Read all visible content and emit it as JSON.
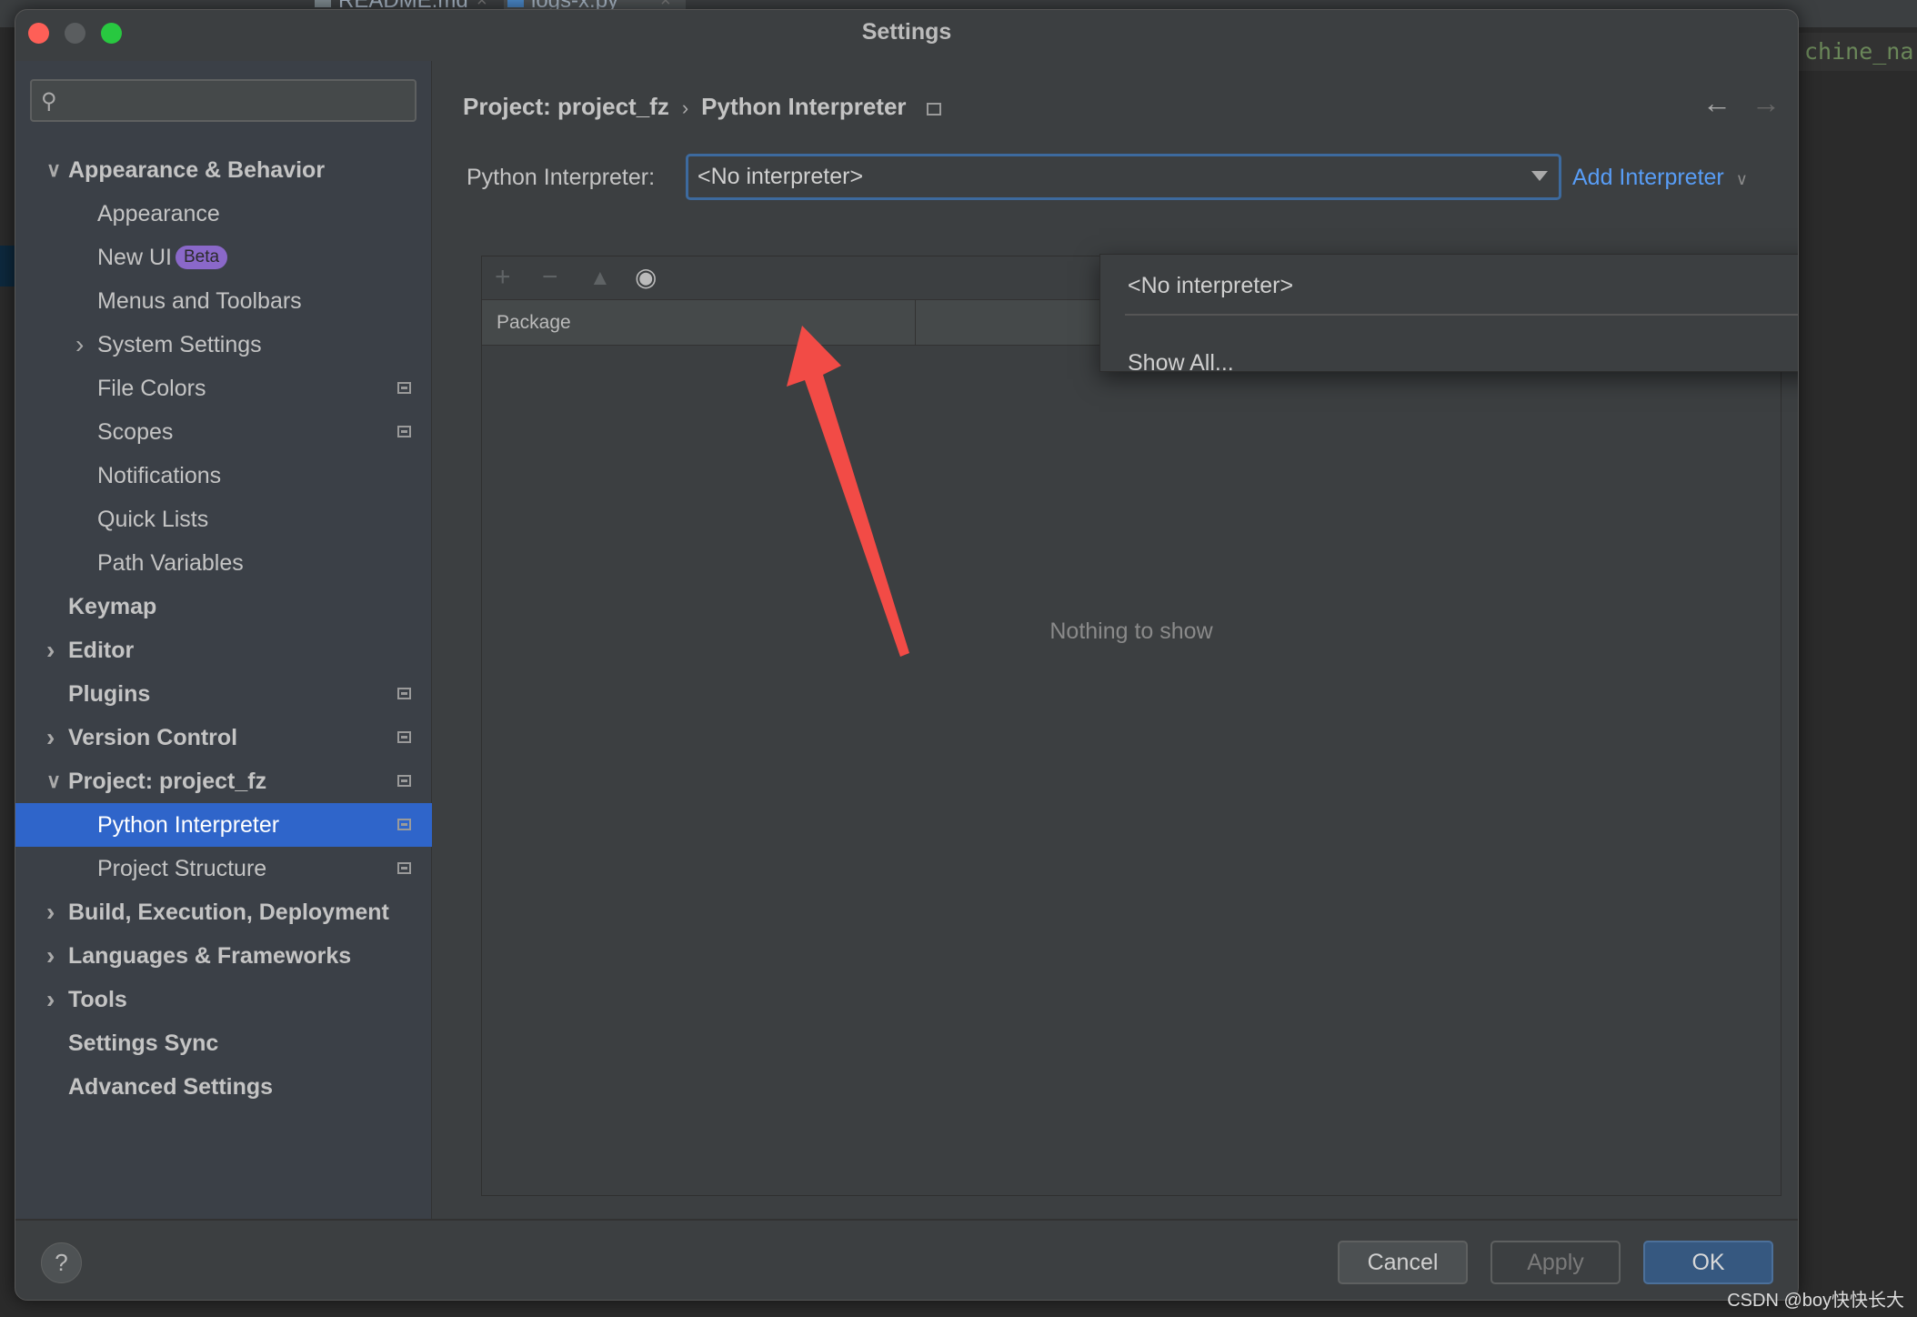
{
  "background": {
    "editor_text": "chine_na",
    "tabs": [
      "README.md",
      "logs-x.py"
    ]
  },
  "window": {
    "title": "Settings"
  },
  "sidebar": {
    "search_placeholder": "",
    "items": [
      {
        "label": "Appearance & Behavior",
        "level": 0,
        "bold": true,
        "chevron": "down"
      },
      {
        "label": "Appearance",
        "level": 1
      },
      {
        "label": "New UI",
        "level": 1,
        "badge": "Beta"
      },
      {
        "label": "Menus and Toolbars",
        "level": 1
      },
      {
        "label": "System Settings",
        "level": 1,
        "chevron": "right"
      },
      {
        "label": "File Colors",
        "level": 1,
        "project_icon": true
      },
      {
        "label": "Scopes",
        "level": 1,
        "project_icon": true
      },
      {
        "label": "Notifications",
        "level": 1
      },
      {
        "label": "Quick Lists",
        "level": 1
      },
      {
        "label": "Path Variables",
        "level": 1
      },
      {
        "label": "Keymap",
        "level": 0,
        "bold": true
      },
      {
        "label": "Editor",
        "level": 0,
        "bold": true,
        "chevron": "right"
      },
      {
        "label": "Plugins",
        "level": 0,
        "bold": true,
        "project_icon": true
      },
      {
        "label": "Version Control",
        "level": 0,
        "bold": true,
        "chevron": "right",
        "project_icon": true
      },
      {
        "label": "Project: project_fz",
        "level": 0,
        "bold": true,
        "chevron": "down",
        "project_icon": true
      },
      {
        "label": "Python Interpreter",
        "level": 1,
        "selected": true,
        "project_icon": true
      },
      {
        "label": "Project Structure",
        "level": 1,
        "project_icon": true
      },
      {
        "label": "Build, Execution, Deployment",
        "level": 0,
        "bold": true,
        "chevron": "right"
      },
      {
        "label": "Languages & Frameworks",
        "level": 0,
        "bold": true,
        "chevron": "right"
      },
      {
        "label": "Tools",
        "level": 0,
        "bold": true,
        "chevron": "right"
      },
      {
        "label": "Settings Sync",
        "level": 0,
        "bold": true
      },
      {
        "label": "Advanced Settings",
        "level": 0,
        "bold": true
      }
    ]
  },
  "main": {
    "breadcrumb": [
      "Project: project_fz",
      "Python Interpreter"
    ],
    "interpreter_label": "Python Interpreter:",
    "interpreter_value": "<No interpreter>",
    "add_interpreter": "Add Interpreter",
    "dropdown_options": [
      "<No interpreter>",
      "Show All..."
    ],
    "table_columns": [
      "Package",
      "",
      ""
    ],
    "empty_text": "Nothing to show"
  },
  "footer": {
    "cancel": "Cancel",
    "apply": "Apply",
    "ok": "OK",
    "help": "?"
  },
  "colors": {
    "selection": "#2f65ca",
    "link": "#589df6",
    "ok_button": "#365880",
    "annotation_arrow": "#f24b46"
  },
  "watermark": "CSDN @boy快快长大"
}
